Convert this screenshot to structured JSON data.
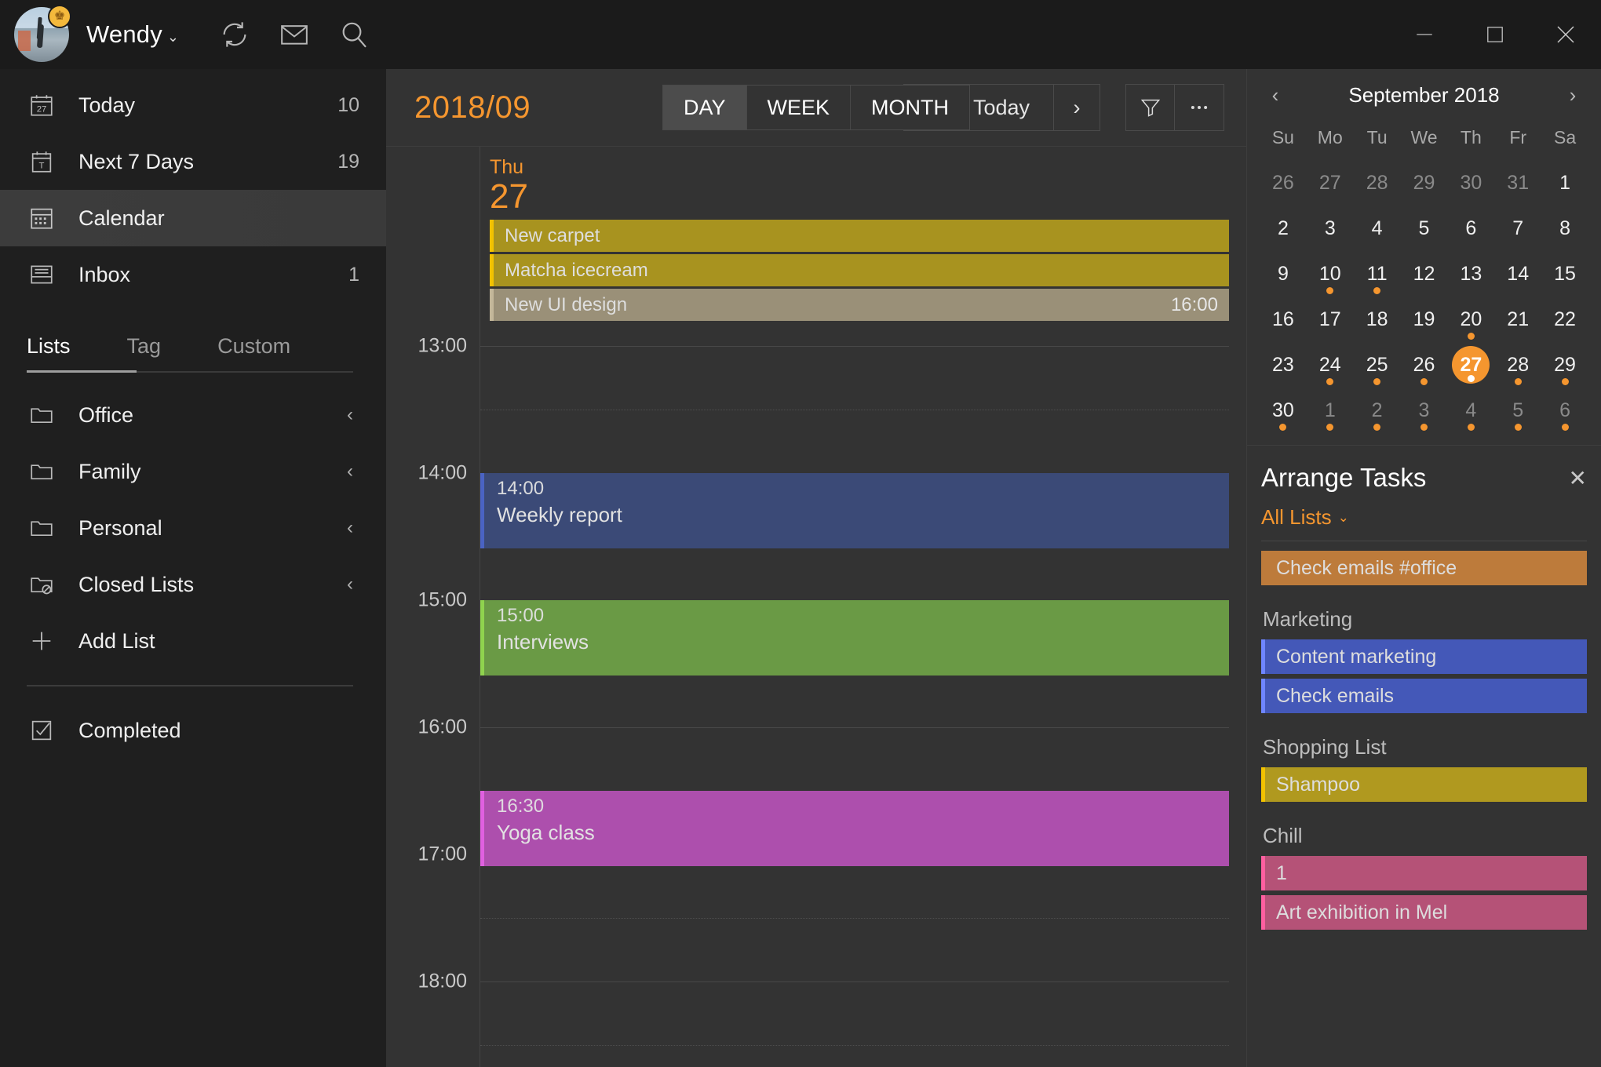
{
  "titlebar": {
    "user": "Wendy",
    "chevron": "⌄",
    "icons": [
      {
        "name": "sync-icon"
      },
      {
        "name": "mail-icon"
      },
      {
        "name": "search-icon"
      }
    ],
    "window": {
      "minimize": "minimize-icon",
      "maximize": "maximize-icon",
      "close": "close-icon"
    }
  },
  "sidebar": {
    "nav": [
      {
        "label": "Today",
        "count": "10",
        "icon": "calendar-27-icon",
        "active": false
      },
      {
        "label": "Next 7 Days",
        "count": "19",
        "icon": "calendar-7-icon",
        "active": false
      },
      {
        "label": "Calendar",
        "count": "",
        "icon": "calendar-grid-icon",
        "active": true
      },
      {
        "label": "Inbox",
        "count": "1",
        "icon": "inbox-icon",
        "active": false
      }
    ],
    "tabs": [
      {
        "label": "Lists",
        "active": true
      },
      {
        "label": "Tag",
        "active": false
      },
      {
        "label": "Custom",
        "active": false
      }
    ],
    "lists": [
      {
        "label": "Office",
        "icon": "folder-icon",
        "chevron": "‹"
      },
      {
        "label": "Family",
        "icon": "folder-icon",
        "chevron": "‹"
      },
      {
        "label": "Personal",
        "icon": "folder-icon",
        "chevron": "‹"
      },
      {
        "label": "Closed Lists",
        "icon": "folder-blocked-icon",
        "chevron": "‹"
      },
      {
        "label": "Add List",
        "icon": "plus-icon",
        "chevron": ""
      }
    ],
    "completed": {
      "label": "Completed",
      "icon": "checkbox-checked-icon"
    }
  },
  "calendar": {
    "month_label": "2018/09",
    "view_modes": [
      {
        "label": "DAY",
        "active": true
      },
      {
        "label": "WEEK",
        "active": false
      },
      {
        "label": "MONTH",
        "active": false
      }
    ],
    "nav": {
      "prev": "‹",
      "today": "Today",
      "next": "›"
    },
    "tools": [
      {
        "name": "filter-icon"
      },
      {
        "name": "more-icon",
        "label": "•••"
      }
    ],
    "day": {
      "weekday": "Thu",
      "number": "27"
    },
    "allday_events": [
      {
        "title": "New carpet",
        "time": "",
        "bg": "#a8931f",
        "bar": "#f2c200"
      },
      {
        "title": "Matcha icecream",
        "time": "",
        "bg": "#a8931f",
        "bar": "#f2c200"
      },
      {
        "title": "New UI design",
        "time": "16:00",
        "bg": "#9a9078",
        "bar": "#c3b79a"
      }
    ],
    "hours": [
      "13:00",
      "14:00",
      "15:00",
      "16:00",
      "17:00",
      "18:00"
    ],
    "events": [
      {
        "time": "14:00",
        "title": "Weekly report",
        "bg": "#3b4a77",
        "bar": "#4a63c4",
        "start_hour": 14.0,
        "end_hour": 14.75
      },
      {
        "time": "15:00",
        "title": "Interviews",
        "bg": "#6a9a45",
        "bar": "#8fd34e",
        "start_hour": 15.0,
        "end_hour": 15.75
      },
      {
        "time": "16:30",
        "title": "Yoga class",
        "bg": "#ad4fad",
        "bar": "#e060e0",
        "start_hour": 16.5,
        "end_hour": 17.25
      }
    ]
  },
  "mini_calendar": {
    "title": "September 2018",
    "prev": "‹",
    "next": "›",
    "dow": [
      "Su",
      "Mo",
      "Tu",
      "We",
      "Th",
      "Fr",
      "Sa"
    ],
    "weeks": [
      [
        {
          "d": "26",
          "other": true,
          "dot": false
        },
        {
          "d": "27",
          "other": true,
          "dot": false
        },
        {
          "d": "28",
          "other": true,
          "dot": false
        },
        {
          "d": "29",
          "other": true,
          "dot": false
        },
        {
          "d": "30",
          "other": true,
          "dot": false
        },
        {
          "d": "31",
          "other": true,
          "dot": false
        },
        {
          "d": "1",
          "other": false,
          "dot": false
        }
      ],
      [
        {
          "d": "2",
          "other": false,
          "dot": false
        },
        {
          "d": "3",
          "other": false,
          "dot": false
        },
        {
          "d": "4",
          "other": false,
          "dot": false
        },
        {
          "d": "5",
          "other": false,
          "dot": false
        },
        {
          "d": "6",
          "other": false,
          "dot": false
        },
        {
          "d": "7",
          "other": false,
          "dot": false
        },
        {
          "d": "8",
          "other": false,
          "dot": false
        }
      ],
      [
        {
          "d": "9",
          "other": false,
          "dot": false
        },
        {
          "d": "10",
          "other": false,
          "dot": true
        },
        {
          "d": "11",
          "other": false,
          "dot": true
        },
        {
          "d": "12",
          "other": false,
          "dot": false
        },
        {
          "d": "13",
          "other": false,
          "dot": false
        },
        {
          "d": "14",
          "other": false,
          "dot": false
        },
        {
          "d": "15",
          "other": false,
          "dot": false
        }
      ],
      [
        {
          "d": "16",
          "other": false,
          "dot": false
        },
        {
          "d": "17",
          "other": false,
          "dot": false
        },
        {
          "d": "18",
          "other": false,
          "dot": false
        },
        {
          "d": "19",
          "other": false,
          "dot": false
        },
        {
          "d": "20",
          "other": false,
          "dot": true
        },
        {
          "d": "21",
          "other": false,
          "dot": false
        },
        {
          "d": "22",
          "other": false,
          "dot": false
        }
      ],
      [
        {
          "d": "23",
          "other": false,
          "dot": false
        },
        {
          "d": "24",
          "other": false,
          "dot": true
        },
        {
          "d": "25",
          "other": false,
          "dot": true
        },
        {
          "d": "26",
          "other": false,
          "dot": true
        },
        {
          "d": "27",
          "other": false,
          "dot": true,
          "today": true
        },
        {
          "d": "28",
          "other": false,
          "dot": true
        },
        {
          "d": "29",
          "other": false,
          "dot": true
        }
      ],
      [
        {
          "d": "30",
          "other": false,
          "dot": true
        },
        {
          "d": "1",
          "other": true,
          "dot": true
        },
        {
          "d": "2",
          "other": true,
          "dot": true
        },
        {
          "d": "3",
          "other": true,
          "dot": true
        },
        {
          "d": "4",
          "other": true,
          "dot": true
        },
        {
          "d": "5",
          "other": true,
          "dot": true
        },
        {
          "d": "6",
          "other": true,
          "dot": true
        }
      ]
    ]
  },
  "arrange_tasks": {
    "title": "Arrange Tasks",
    "close": "✕",
    "filter_label": "All Lists",
    "filter_chevron": "⌄",
    "ungrouped": [
      {
        "title": "Check emails #office",
        "bg": "#bd7b3b",
        "bar": "#bd7b3b"
      }
    ],
    "groups": [
      {
        "label": "Marketing",
        "tasks": [
          {
            "title": "Content marketing",
            "bg": "#4458b8",
            "bar": "#6f86ff"
          },
          {
            "title": "Check emails",
            "bg": "#4458b8",
            "bar": "#6f86ff"
          }
        ]
      },
      {
        "label": "Shopping List",
        "tasks": [
          {
            "title": "Shampoo",
            "bg": "#b0991f",
            "bar": "#f2c200"
          }
        ]
      },
      {
        "label": "Chill",
        "tasks": [
          {
            "title": "1",
            "bg": "#b55277",
            "bar": "#ff5fa0"
          },
          {
            "title": "Art exhibition in Mel",
            "bg": "#b55277",
            "bar": "#ff5fa0"
          }
        ]
      }
    ]
  },
  "colors": {
    "accent": "#f5962f",
    "sidebar_bg": "#1f1f1f",
    "panel_bg": "#333333",
    "titlebar_bg": "#1b1b1b"
  }
}
